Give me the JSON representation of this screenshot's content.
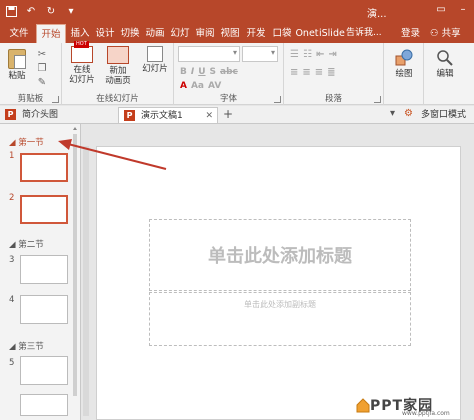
{
  "titlebar": {
    "title": "演...",
    "qat": [
      "save",
      "undo",
      "redo",
      "customize"
    ]
  },
  "tabs": {
    "file": "文件",
    "home": "开始",
    "insert": "插入",
    "design": "设计",
    "transitions": "切换",
    "animations": "动画",
    "slideshow": "幻灯",
    "review": "审阅",
    "view": "视图",
    "developer": "开发",
    "pocket": "口袋",
    "onekey": "Onet",
    "islide": "iSlide",
    "tell": "告诉我...",
    "login": "登录",
    "share": "共享"
  },
  "ribbon": {
    "paste": "粘贴",
    "clipboard": "剪贴板",
    "online_slides_1": "在线",
    "online_slides_2": "幻灯片",
    "new_slide_1": "新加",
    "new_slide_2": "动画页",
    "slides_button": "幻灯片",
    "online_group": "在线幻灯片",
    "font_group": "字体",
    "paragraph_group": "段落",
    "drawing": "绘图",
    "editing": "编辑"
  },
  "doctabs": {
    "tab1": "简介头图",
    "tab2": "演示文稿1",
    "multi_window": "多窗口模式"
  },
  "thumbs": {
    "section1": "第一节",
    "section2": "第二节",
    "section3": "第三节",
    "slide_numbers": [
      "1",
      "2",
      "3",
      "4",
      "5"
    ]
  },
  "slide": {
    "title_placeholder": "单击此处添加标题",
    "subtitle_placeholder": "单击此处添加副标题"
  },
  "watermark": {
    "text": "PPT家园",
    "sub": "www.pptjia.com"
  },
  "colors": {
    "accent": "#b7472a",
    "selected_thumb": "#d0573a",
    "arrow": "#c0392b"
  }
}
